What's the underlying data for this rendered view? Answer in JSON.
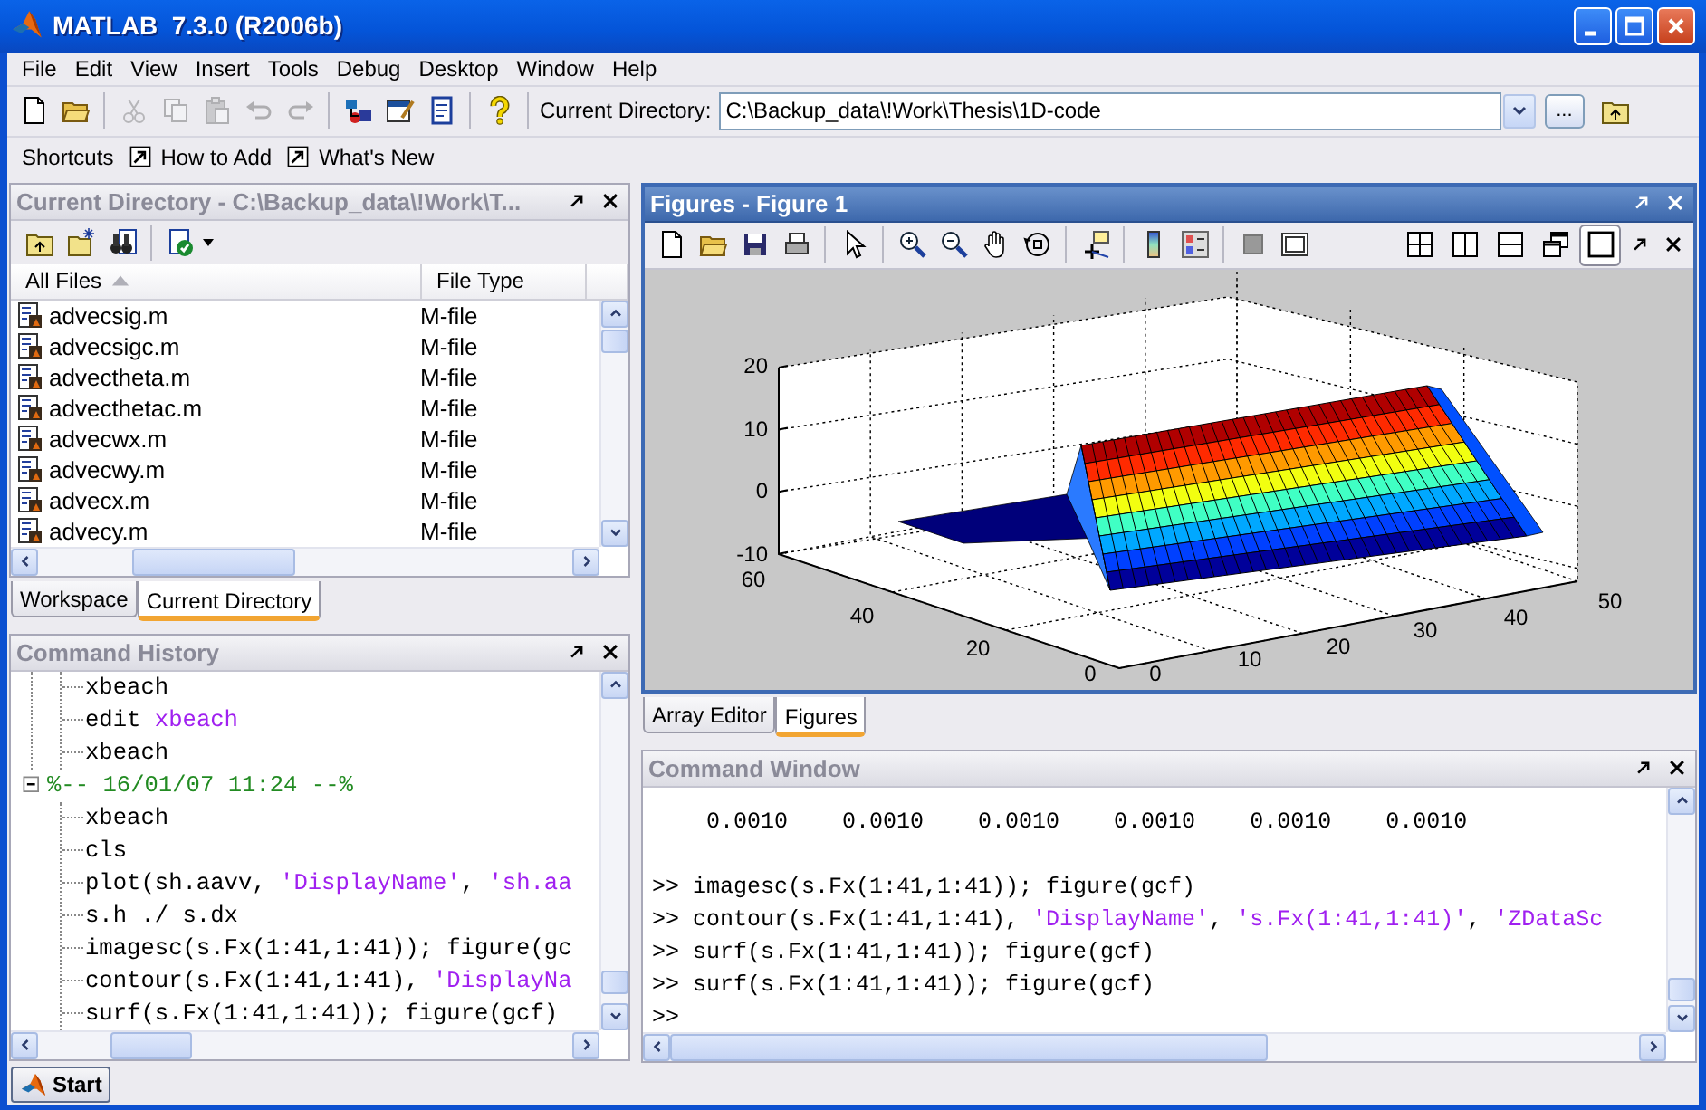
{
  "window": {
    "title": "MATLAB  7.3.0 (R2006b)"
  },
  "menu": [
    "File",
    "Edit",
    "View",
    "Insert",
    "Tools",
    "Debug",
    "Desktop",
    "Window",
    "Help"
  ],
  "toolbar": {
    "buttons": [
      {
        "disabled": false
      },
      {
        "disabled": false
      },
      {
        "disabled": true
      },
      {
        "disabled": true
      },
      {
        "disabled": true
      },
      {
        "disabled": true
      },
      {
        "disabled": true
      },
      {
        "disabled": false
      },
      {
        "disabled": false
      },
      {
        "disabled": false
      },
      {
        "disabled": false
      }
    ],
    "directory_label": "Current Directory:",
    "directory_value": "C:\\Backup_data\\!Work\\Thesis\\1D-code",
    "browse_button": "..."
  },
  "shortcuts": {
    "label": "Shortcuts",
    "items": [
      "How to Add",
      "What's New"
    ]
  },
  "current_directory": {
    "title": "Current Directory - C:\\Backup_data\\!Work\\T...",
    "columns": [
      {
        "label": "All Files",
        "sorted": true
      },
      {
        "label": "File Type",
        "sorted": false
      }
    ],
    "files": [
      {
        "name": "advecsig.m",
        "type": "M-file"
      },
      {
        "name": "advecsigc.m",
        "type": "M-file"
      },
      {
        "name": "advectheta.m",
        "type": "M-file"
      },
      {
        "name": "advecthetac.m",
        "type": "M-file"
      },
      {
        "name": "advecwx.m",
        "type": "M-file"
      },
      {
        "name": "advecwy.m",
        "type": "M-file"
      },
      {
        "name": "advecx.m",
        "type": "M-file"
      },
      {
        "name": "advecy.m",
        "type": "M-file"
      }
    ]
  },
  "left_tabs": [
    {
      "label": "Workspace",
      "selected": false
    },
    {
      "label": "Current Directory",
      "selected": true
    }
  ],
  "command_history": {
    "title": "Command History",
    "groups": [
      {
        "children": [
          {
            "segments": [
              {
                "text": "xbeach",
                "kind": "code"
              }
            ]
          },
          {
            "segments": [
              {
                "text": "edit ",
                "kind": "code"
              },
              {
                "text": "xbeach",
                "kind": "string"
              }
            ]
          },
          {
            "segments": [
              {
                "text": "xbeach",
                "kind": "code"
              }
            ]
          }
        ]
      },
      {
        "header": "%-- 16/01/07 11:24 --%",
        "expanded": true,
        "children": [
          {
            "segments": [
              {
                "text": "xbeach",
                "kind": "code"
              }
            ]
          },
          {
            "segments": [
              {
                "text": "cls",
                "kind": "code"
              }
            ]
          },
          {
            "segments": [
              {
                "text": "plot(sh.aavv, ",
                "kind": "code"
              },
              {
                "text": "'DisplayName'",
                "kind": "string"
              },
              {
                "text": ", ",
                "kind": "code"
              },
              {
                "text": "'sh.aa",
                "kind": "string"
              }
            ]
          },
          {
            "segments": [
              {
                "text": "s.h ./ s.dx",
                "kind": "code"
              }
            ]
          },
          {
            "segments": [
              {
                "text": "imagesc(s.Fx(1:41,1:41)); figure(gc",
                "kind": "code"
              }
            ]
          },
          {
            "segments": [
              {
                "text": "contour(s.Fx(1:41,1:41), ",
                "kind": "code"
              },
              {
                "text": "'DisplayNa",
                "kind": "string"
              }
            ]
          },
          {
            "segments": [
              {
                "text": "surf(s.Fx(1:41,1:41)); figure(gcf)",
                "kind": "code"
              }
            ]
          }
        ]
      }
    ]
  },
  "figures": {
    "title": "Figures - Figure 1",
    "layouts": [
      {
        "selected": false
      },
      {
        "selected": false
      },
      {
        "selected": false
      },
      {
        "selected": false
      },
      {
        "selected": true
      }
    ],
    "axes": {
      "z_ticks": [
        "20",
        "10",
        "0",
        "-10"
      ],
      "y_ticks": [
        "60",
        "40",
        "20",
        "0"
      ],
      "x_ticks": [
        "0",
        "10",
        "20",
        "30",
        "40",
        "50"
      ]
    }
  },
  "right_tabs": [
    {
      "label": "Array Editor",
      "selected": false
    },
    {
      "label": "Figures",
      "selected": true
    }
  ],
  "command_window": {
    "title": "Command Window",
    "output": [
      [
        "0.0010",
        "0.0010",
        "0.0010",
        "0.0010",
        "0.0010",
        "0.0010"
      ]
    ],
    "lines": [
      {
        "prompt": ">>",
        "segments": [
          {
            "text": "imagesc(s.Fx(1:41,1:41)); figure(gcf)",
            "kind": "code"
          }
        ]
      },
      {
        "prompt": ">>",
        "segments": [
          {
            "text": "contour(s.Fx(1:41,1:41), ",
            "kind": "code"
          },
          {
            "text": "'DisplayName'",
            "kind": "string"
          },
          {
            "text": ", ",
            "kind": "code"
          },
          {
            "text": "'s.Fx(1:41,1:41)'",
            "kind": "string"
          },
          {
            "text": ", ",
            "kind": "code"
          },
          {
            "text": "'ZDataSc",
            "kind": "string"
          }
        ]
      },
      {
        "prompt": ">>",
        "segments": [
          {
            "text": "surf(s.Fx(1:41,1:41)); figure(gcf)",
            "kind": "code"
          }
        ]
      },
      {
        "prompt": ">>",
        "segments": [
          {
            "text": "surf(s.Fx(1:41,1:41)); figure(gcf)",
            "kind": "code"
          }
        ]
      },
      {
        "prompt": ">>"
      }
    ]
  },
  "start": {
    "label": "Start"
  }
}
